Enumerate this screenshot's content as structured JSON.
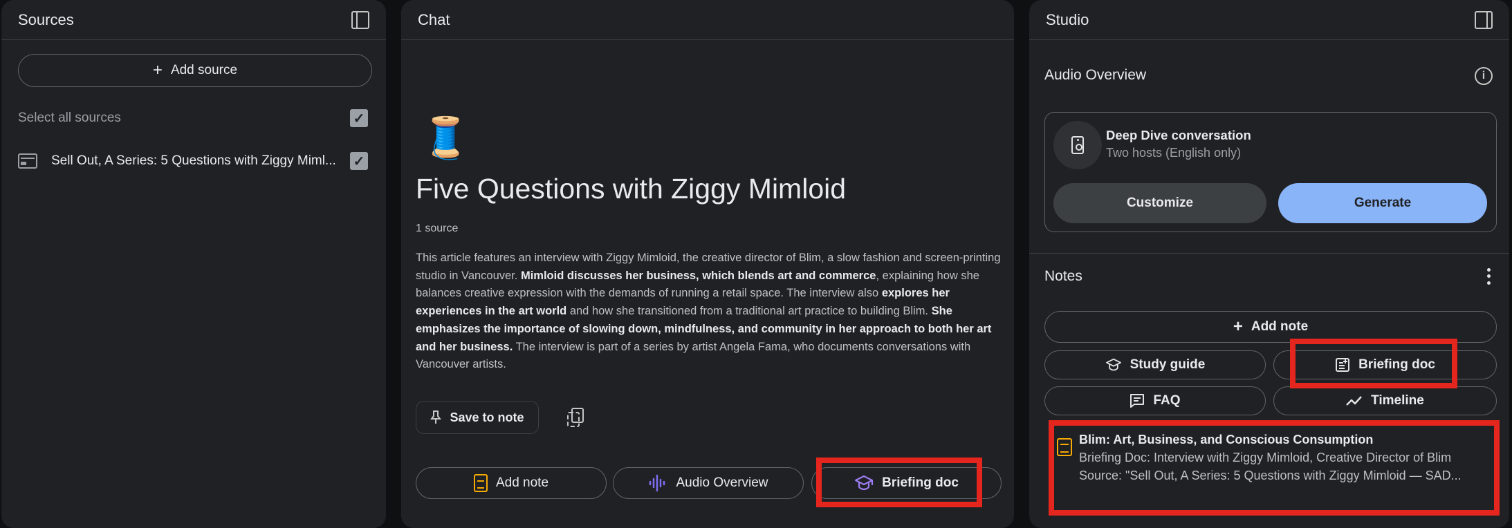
{
  "sources": {
    "title": "Sources",
    "add_source": "Add source",
    "select_all": "Select all sources",
    "items": [
      {
        "label": "Sell Out, A Series: 5 Questions with Ziggy Miml..."
      }
    ]
  },
  "chat": {
    "title": "Chat",
    "emoji": "🧵",
    "heading": "Five Questions with Ziggy Mimloid",
    "source_count": "1 source",
    "summary": {
      "p1": "This article features an interview with Ziggy Mimloid, the creative director of Blim, a slow fashion and screen-printing studio in Vancouver. ",
      "b1": "Mimloid discusses her business, which blends art and commerce",
      "p2": ", explaining how she balances creative expression with the demands of running a retail space. The interview also ",
      "b2": "explores her experiences in the art world",
      "p3": " and how she transitioned from a traditional art practice to building Blim. ",
      "b3": "She emphasizes the importance of slowing down, mindfulness, and community in her approach to both her art and her business.",
      "p4": " The interview is part of a series by artist Angela Fama, who documents conversations with Vancouver artists."
    },
    "save_to_note": "Save to note",
    "chips": {
      "add_note": "Add note",
      "audio_overview": "Audio Overview",
      "briefing_doc": "Briefing doc"
    }
  },
  "studio": {
    "title": "Studio",
    "audio_overview": {
      "title": "Audio Overview",
      "card_title": "Deep Dive conversation",
      "card_subtitle": "Two hosts (English only)",
      "customize": "Customize",
      "generate": "Generate"
    },
    "notes": {
      "title": "Notes",
      "add_note": "Add note",
      "buttons": {
        "study_guide": "Study guide",
        "briefing_doc": "Briefing doc",
        "faq": "FAQ",
        "timeline": "Timeline"
      },
      "items": [
        {
          "title": "Blim: Art, Business, and Conscious Consumption",
          "line1": "Briefing Doc: Interview with Ziggy Mimloid, Creative Director of Blim",
          "line2": "Source: \"Sell Out, A Series: 5 Questions with Ziggy Mimloid — SAD..."
        }
      ]
    }
  },
  "colors": {
    "background": "#0f1011",
    "panel": "#202124",
    "accent_blue": "#8ab4f8",
    "note_yellow": "#f9ab00",
    "audio_purple": "#7c6ff2",
    "highlight_red": "#e5261e"
  },
  "icons": [
    "sidebar-collapse-icon",
    "plus-icon",
    "checkbox-icon",
    "article-icon",
    "pin-icon",
    "copy-icon",
    "document-icon",
    "audio-waveform-icon",
    "graduation-cap-icon",
    "info-icon",
    "speaker-icon",
    "more-vert-icon",
    "note-add-icon",
    "quiz-icon",
    "trend-icon",
    "note-icon"
  ]
}
